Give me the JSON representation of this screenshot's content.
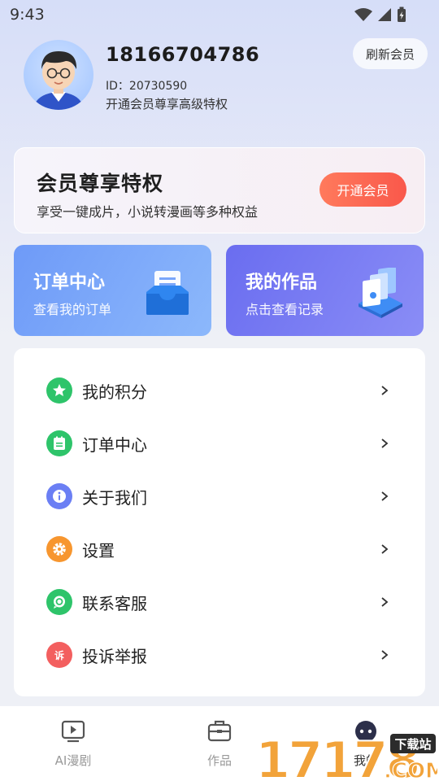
{
  "status_bar": {
    "time": "9:43"
  },
  "profile": {
    "phone": "18166704786",
    "id_line": "ID：20730590",
    "vip_hint": "开通会员尊享高级特权",
    "refresh_label": "刷新会员"
  },
  "vip_card": {
    "title": "会员尊享特权",
    "subtitle": "享受一键成片，小说转漫画等多种权益",
    "button_label": "开通会员"
  },
  "quick_cards": [
    {
      "title": "订单中心",
      "subtitle": "查看我的订单",
      "icon": "inbox-tray-icon",
      "color": "#6e9af8"
    },
    {
      "title": "我的作品",
      "subtitle": "点击查看记录",
      "icon": "documents-stack-icon",
      "color": "#6a6df0"
    }
  ],
  "menu": [
    {
      "label": "我的积分",
      "icon": "star-icon",
      "color": "#2ec46a"
    },
    {
      "label": "订单中心",
      "icon": "notepad-icon",
      "color": "#2ec46a"
    },
    {
      "label": "关于我们",
      "icon": "info-icon",
      "color": "#6b7ff4"
    },
    {
      "label": "设置",
      "icon": "gear-icon",
      "color": "#f7962f"
    },
    {
      "label": "联系客服",
      "icon": "chat-icon",
      "color": "#2ec46a"
    },
    {
      "label": "投诉举报",
      "icon": "complaint-icon",
      "color": "#f35f5f",
      "badge": "诉"
    }
  ],
  "tabbar": [
    {
      "label": "AI漫剧",
      "icon": "play-screen-icon",
      "active": false
    },
    {
      "label": "作品",
      "icon": "briefcase-icon",
      "active": false
    },
    {
      "label": "我的",
      "icon": "robot-avatar-icon",
      "active": true
    }
  ],
  "watermark": {
    "number": "17178",
    "site_tag": "下载站",
    "domain": ".COM"
  }
}
